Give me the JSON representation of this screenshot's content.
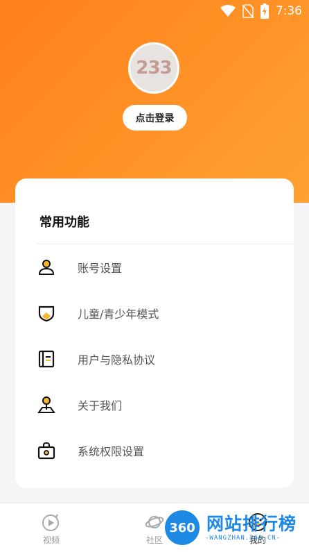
{
  "status_bar": {
    "time": "7:36",
    "icons": [
      "wifi-icon",
      "no-sim-icon",
      "battery-charging-icon"
    ]
  },
  "profile": {
    "avatar_text": "233",
    "login_label": "点击登录"
  },
  "features": {
    "title": "常用功能",
    "items": [
      {
        "label": "账号设置",
        "icon": "user-icon"
      },
      {
        "label": "儿童/青少年模式",
        "icon": "shield-icon"
      },
      {
        "label": "用户与隐私协议",
        "icon": "document-icon"
      },
      {
        "label": "关于我们",
        "icon": "location-person-icon"
      },
      {
        "label": "系统权限设置",
        "icon": "lock-bag-icon"
      }
    ]
  },
  "nav": {
    "items": [
      {
        "label": "视频",
        "icon": "video-play-icon"
      },
      {
        "label": "社区",
        "icon": "planet-icon"
      },
      {
        "label": "我的",
        "icon": "smile-icon"
      }
    ]
  },
  "watermark": {
    "badge": "360",
    "title": "网站排行榜",
    "subtitle": "-WANGZHAN.360.CN-"
  },
  "colors": {
    "header_start": "#ff7f1e",
    "header_end": "#ffa233",
    "icon_accent": "#f5b82e"
  }
}
